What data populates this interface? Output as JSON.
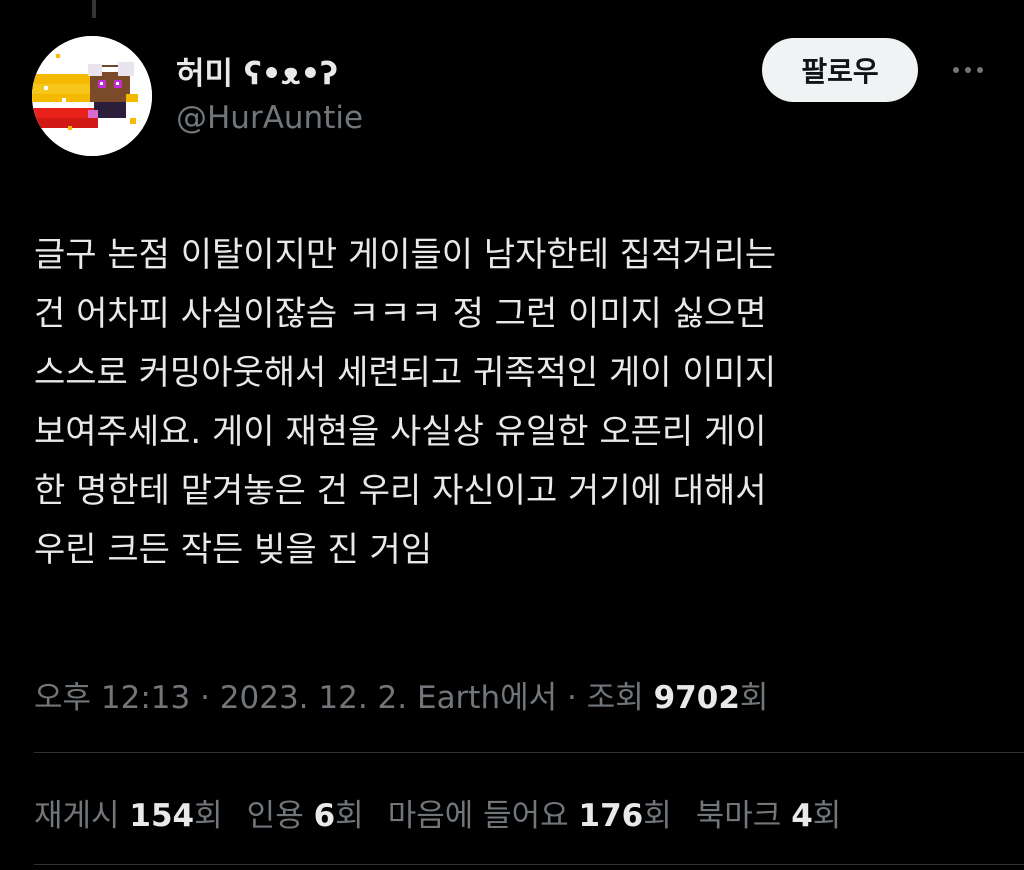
{
  "author": {
    "display_name": "허미 ʕ•ᴥ•ʔ",
    "handle": "@HurAuntie"
  },
  "follow_label": "팔로우",
  "more_icon": "more-horizontal-icon",
  "tweet": {
    "lines": [
      "글구 논점 이탈이지만 게이들이 남자한테 집적거리는",
      "건 어차피 사실이잖슴 ㅋㅋㅋ 정 그런 이미지 싫으면",
      "스스로 커밍아웃해서 세련되고 귀족적인 게이 이미지",
      "보여주세요. 게이 재현을 사실상 유일한 오픈리 게이",
      "한 명한테 맡겨놓은 건 우리 자신이고 거기에 대해서",
      "우린 크든 작든 빚을 진 거임"
    ]
  },
  "meta": {
    "time_date_source": "오후 12:13 · 2023. 12. 2. Earth에서 · 조회 ",
    "views": "9702",
    "views_suffix": "회"
  },
  "stats": {
    "retweets_label": "재게시 ",
    "retweets": "154",
    "retweets_suffix": "회",
    "quotes_label": "인용 ",
    "quotes": "6",
    "quotes_suffix": "회",
    "likes_label": "마음에 들어요 ",
    "likes": "176",
    "likes_suffix": "회",
    "bookmarks_label": "북마크 ",
    "bookmarks": "4",
    "bookmarks_suffix": "회"
  },
  "colors": {
    "background": "#000000",
    "text_primary": "#e7e9ea",
    "text_secondary": "#71767b",
    "follow_button_bg": "#eff3f4",
    "divider": "#2f3336"
  }
}
